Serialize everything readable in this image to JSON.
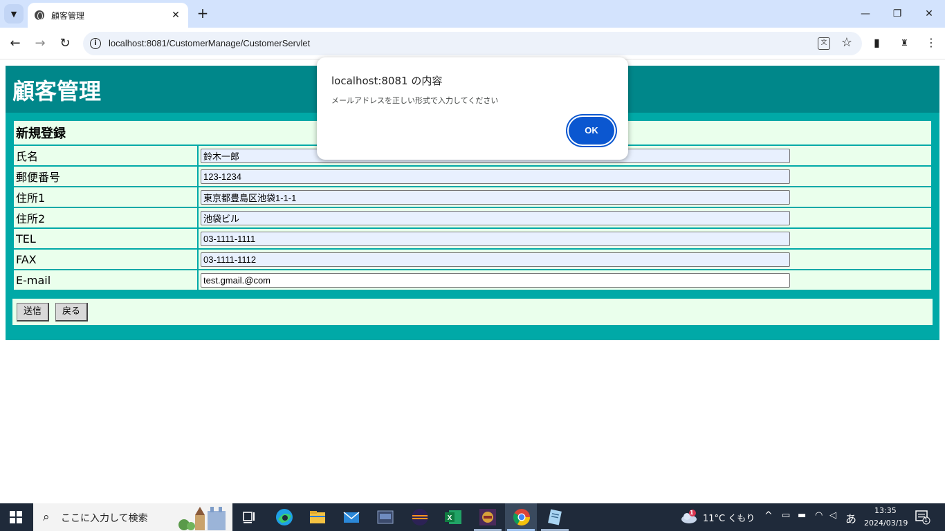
{
  "browser": {
    "tab_title": "顧客管理",
    "tab_close": "✕",
    "new_tab": "+",
    "url": "localhost:8081/CustomerManage/CustomerServlet",
    "minimize": "—",
    "restore": "❐",
    "close": "✕"
  },
  "page": {
    "heading": "顧客管理",
    "form_title": "新規登録",
    "fields": [
      {
        "label": "氏名",
        "value": "鈴木一郎"
      },
      {
        "label": "郵便番号",
        "value": "123-1234"
      },
      {
        "label": "住所1",
        "value": "東京都豊島区池袋1-1-1"
      },
      {
        "label": "住所2",
        "value": "池袋ビル"
      },
      {
        "label": "TEL",
        "value": "03-1111-1111"
      },
      {
        "label": "FAX",
        "value": "03-1111-1112"
      },
      {
        "label": "E-mail",
        "value": "test.gmail.@com"
      }
    ],
    "submit_label": "送信",
    "back_label": "戻る"
  },
  "dialog": {
    "title": "localhost:8081 の内容",
    "message": "メールアドレスを正しい形式で入力してください",
    "ok_label": "OK"
  },
  "taskbar": {
    "search_placeholder": "ここに入力して検索",
    "weather": "11°C くもり",
    "ime": "あ",
    "time": "13:35",
    "date": "2024/03/19",
    "notifications": "1",
    "weather_badge": "1"
  },
  "colors": {
    "header_bg": "#00878a",
    "form_bg": "#00a9a7",
    "cell_bg": "#eaffec",
    "ok_button": "#0b57d0"
  }
}
